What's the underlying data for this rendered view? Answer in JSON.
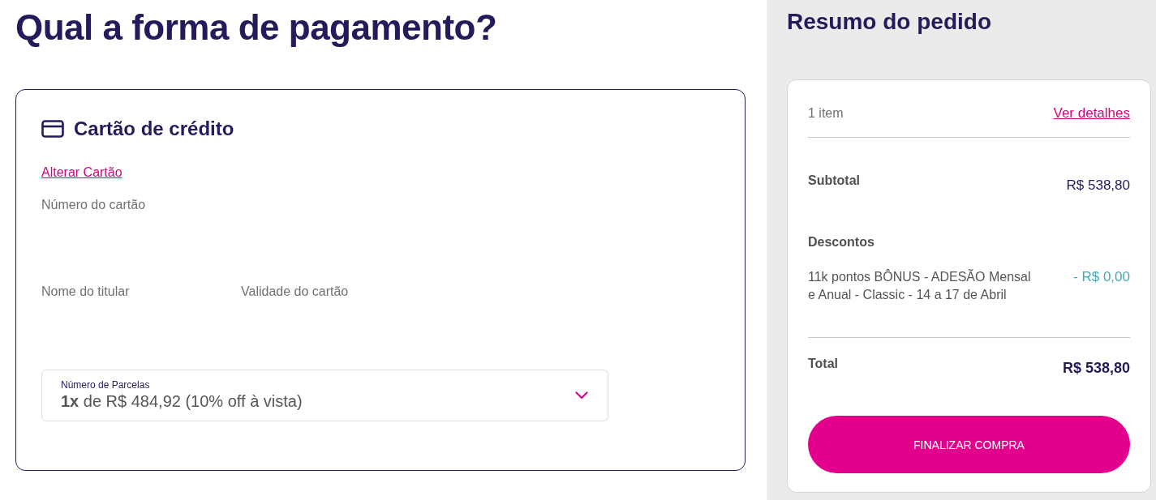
{
  "page": {
    "title": "Qual a forma de pagamento?"
  },
  "payment": {
    "method": {
      "title": "Cartão de crédito"
    },
    "change_link": "Alterar Cartão",
    "card_number": {
      "label": "Número do cartão"
    },
    "holder_name": {
      "label": "Nome do titular"
    },
    "expiry": {
      "label": "Validade do cartão"
    },
    "installments": {
      "label": "Número de Parcelas",
      "value": "**1x** de R$ 484,92 (10% off à vista)"
    }
  },
  "summary": {
    "title": "Resumo do pedido",
    "item_count": "1 item",
    "details_link": "Ver detalhes",
    "subtotal": {
      "label": "Subtotal",
      "value": "R$ 538,80"
    },
    "discounts": {
      "label": "Descontos",
      "items": [
        {
          "description": "11k pontos BÔNUS - ADESÃO Mensal e Anual - Classic - 14 a 17 de Abril",
          "value": "- R$ 0,00"
        }
      ]
    },
    "total": {
      "label": "Total",
      "value": "R$ 538,80"
    },
    "button": "FINALIZAR COMPRA"
  }
}
